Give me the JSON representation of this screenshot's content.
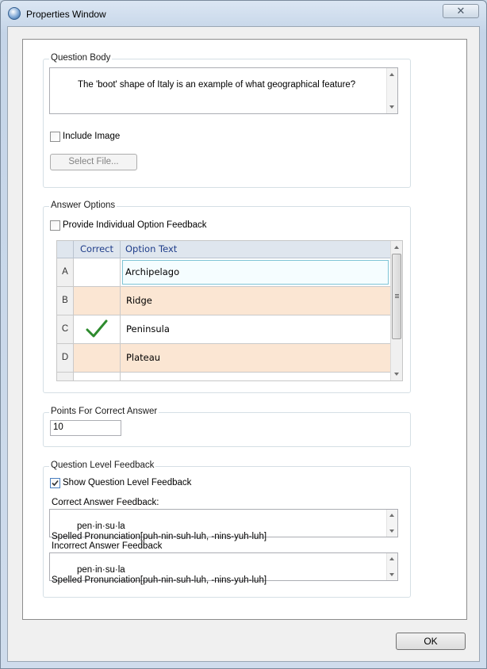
{
  "window": {
    "title": "Properties Window",
    "close_glyph": "✕"
  },
  "question_body": {
    "legend": "Question Body",
    "text": "The 'boot' shape of Italy is an example of what geographical feature?",
    "include_image_label": "Include Image",
    "include_image_checked": false,
    "select_file_label": "Select File..."
  },
  "answer_options": {
    "legend": "Answer Options",
    "provide_feedback_label": "Provide Individual Option Feedback",
    "provide_feedback_checked": false,
    "columns": {
      "correct": "Correct",
      "option_text": "Option Text"
    },
    "rows": [
      {
        "letter": "A",
        "text": "Archipelago",
        "correct": false
      },
      {
        "letter": "B",
        "text": "Ridge",
        "correct": false
      },
      {
        "letter": "C",
        "text": "Peninsula",
        "correct": true
      },
      {
        "letter": "D",
        "text": "Plateau",
        "correct": false
      }
    ]
  },
  "points": {
    "legend": "Points For Correct Answer",
    "value": "10"
  },
  "question_feedback": {
    "legend": "Question Level Feedback",
    "show_label": "Show Question Level Feedback",
    "show_checked": true,
    "correct_label": "Correct Answer Feedback:",
    "correct_text": "pen·in·su·la\nSpelled Pronunciation[puh-nin-suh-luh, -nins-yuh-luh]",
    "incorrect_label": "Incorrect Answer Feedback",
    "incorrect_text": "pen·in·su·la\nSpelled Pronunciation[puh-nin-suh-luh, -nins-yuh-luh]"
  },
  "footer": {
    "ok_label": "OK"
  },
  "colors": {
    "alt_row": "#fbe6d3",
    "header_text": "#1f3d8a",
    "checkmark": "#2e8b2e"
  }
}
